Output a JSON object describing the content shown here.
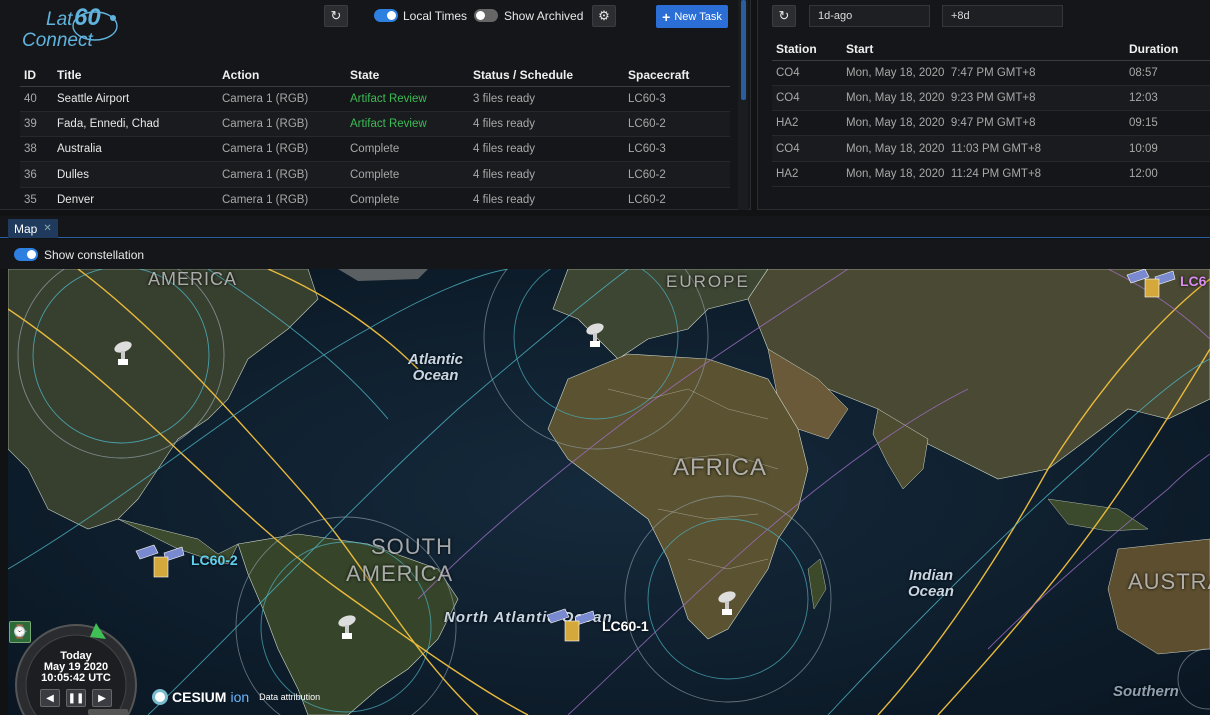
{
  "app": {
    "logo_lat": "Lat",
    "logo_60": "60",
    "logo_connect": "Connect"
  },
  "toolbar": {
    "local_times_label": "Local Times",
    "local_times_on": true,
    "show_archived_label": "Show Archived",
    "show_archived_on": false,
    "new_task_label": "New Task"
  },
  "tasks": {
    "columns": [
      "ID",
      "Title",
      "Action",
      "State",
      "Status / Schedule",
      "Spacecraft"
    ],
    "rows": [
      {
        "id": "40",
        "title": "Seattle Airport",
        "action": "Camera 1 (RGB)",
        "state": "Artifact Review",
        "status": "3 files ready",
        "spacecraft": "LC60-3"
      },
      {
        "id": "39",
        "title": "Fada, Ennedi, Chad",
        "action": "Camera 1 (RGB)",
        "state": "Artifact Review",
        "status": "4 files ready",
        "spacecraft": "LC60-2"
      },
      {
        "id": "38",
        "title": "Australia",
        "action": "Camera 1 (RGB)",
        "state": "Complete",
        "status": "4 files ready",
        "spacecraft": "LC60-3"
      },
      {
        "id": "36",
        "title": "Dulles",
        "action": "Camera 1 (RGB)",
        "state": "Complete",
        "status": "4 files ready",
        "spacecraft": "LC60-2"
      },
      {
        "id": "35",
        "title": "Denver",
        "action": "Camera 1 (RGB)",
        "state": "Complete",
        "status": "4 files ready",
        "spacecraft": "LC60-2"
      }
    ]
  },
  "passes": {
    "range_start": "1d-ago",
    "range_end": "+8d",
    "columns": [
      "Station",
      "Start",
      "Duration"
    ],
    "rows": [
      {
        "station": "CO4",
        "start": "Mon, May 18, 2020  7:47 PM GMT+8",
        "duration": "08:57"
      },
      {
        "station": "CO4",
        "start": "Mon, May 18, 2020  9:23 PM GMT+8",
        "duration": "12:03"
      },
      {
        "station": "HA2",
        "start": "Mon, May 18, 2020  9:47 PM GMT+8",
        "duration": "09:15"
      },
      {
        "station": "CO4",
        "start": "Mon, May 18, 2020  11:03 PM GMT+8",
        "duration": "10:09"
      },
      {
        "station": "HA2",
        "start": "Mon, May 18, 2020  11:24 PM GMT+8",
        "duration": "12:00"
      }
    ]
  },
  "map": {
    "tab_label": "Map",
    "show_constellation_label": "Show constellation",
    "show_constellation_on": true,
    "labels": {
      "america": "AMERICA",
      "europe": "EUROPE",
      "atlantic": "Atlantic\nOcean",
      "africa": "AFRICA",
      "south_america_1": "SOUTH",
      "south_america_2": "AMERICA",
      "north_atlantic": "North Atlantic Ocean",
      "indian": "Indian\nOcean",
      "austral": "AUSTRA",
      "southern": "Southern"
    },
    "satellites": [
      {
        "name": "LC60-2",
        "color": "#5fd0f0"
      },
      {
        "name": "LC60-1",
        "color": "#ffffff"
      },
      {
        "name": "LC6",
        "color": "#d98cf0"
      }
    ],
    "clock": {
      "day": "Today",
      "date": "May 19 2020",
      "time": "10:05:42 UTC"
    },
    "attribution": {
      "cesium": "CESIUM",
      "ion": "ion",
      "data": "Data attribution"
    }
  },
  "colors": {
    "accent": "#2d7fe0",
    "review": "#3dbb55",
    "orbit_yellow": "#e8b93c",
    "orbit_cyan": "#4fb8c8",
    "orbit_purple": "#a070c8"
  }
}
